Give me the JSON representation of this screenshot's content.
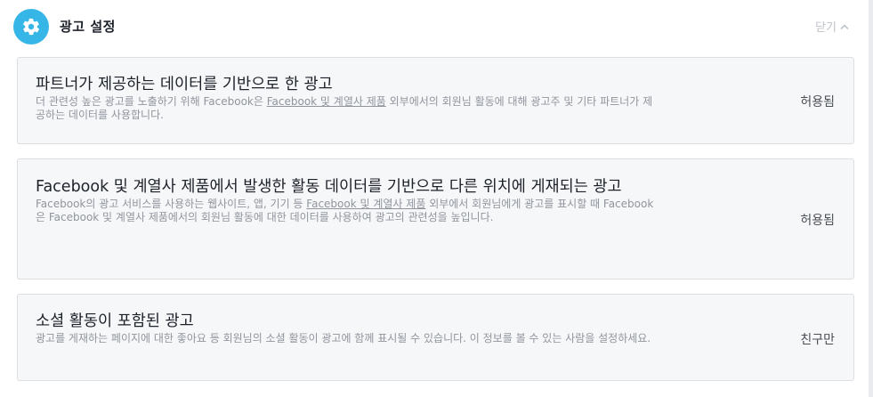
{
  "header": {
    "title": "광고 설정",
    "close_label": "닫기",
    "icon": "gear-icon"
  },
  "cards": [
    {
      "title": "파트너가 제공하는 데이터를 기반으로 한 광고",
      "desc_before": "더 관련성 높은 광고를 노출하기 위해 Facebook은 ",
      "desc_link": "Facebook 및 계열사 제품",
      "desc_after": " 외부에서의 회원님 활동에 대해 광고주 및 기타 파트너가 제공하는 데이터를 사용합니다.",
      "value": "허용됨"
    },
    {
      "title": "Facebook 및 계열사 제품에서 발생한 활동 데이터를 기반으로 다른 위치에 게재되는 광고",
      "desc_before": "Facebook의 광고 서비스를 사용하는 웹사이트, 앱, 기기 등 ",
      "desc_link": "Facebook 및 계열사 제품",
      "desc_after": " 외부에서 회원님에게 광고를 표시할 때 Facebook은 Facebook 및 계열사 제품에서의 회원님 활동에 대한 데이터를 사용하여 광고의 관련성을 높입니다.",
      "value": "허용됨"
    },
    {
      "title": "소셜 활동이 포함된 광고",
      "desc_before": "광고를 게재하는 페이지에 대한 좋아요 등 회원님의 소셜 활동이 광고에 함께 표시될 수 있습니다. 이 정보를 볼 수 있는 사람을 설정하세요.",
      "desc_link": "",
      "desc_after": "",
      "value": "친구만"
    }
  ],
  "colors": {
    "accent": "#36b6e6",
    "card_bg": "#f6f7f9",
    "card_border": "#dddfe2",
    "title_text": "#1d2129",
    "desc_text": "#90949c",
    "value_text": "#4b4f56",
    "close_text": "#bec3c9"
  }
}
